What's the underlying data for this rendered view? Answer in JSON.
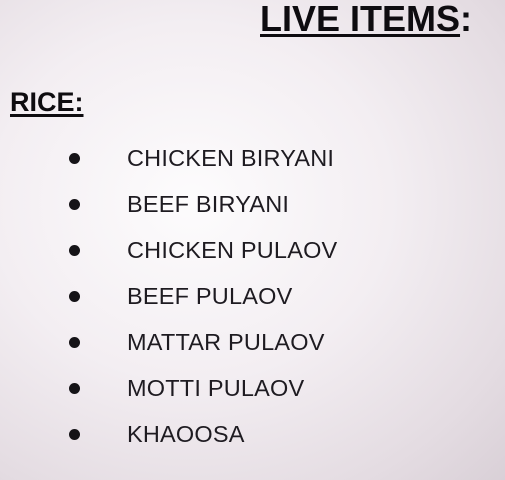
{
  "heading": {
    "title": "LIVE ITEMS",
    "colon": ":"
  },
  "section": {
    "title": "RICE:",
    "items": [
      "CHICKEN BIRYANI",
      "BEEF BIRYANI",
      "CHICKEN PULAOV",
      "BEEF PULAOV",
      "MATTAR PULAOV",
      "MOTTI PULAOV",
      "KHAOOSA"
    ]
  }
}
